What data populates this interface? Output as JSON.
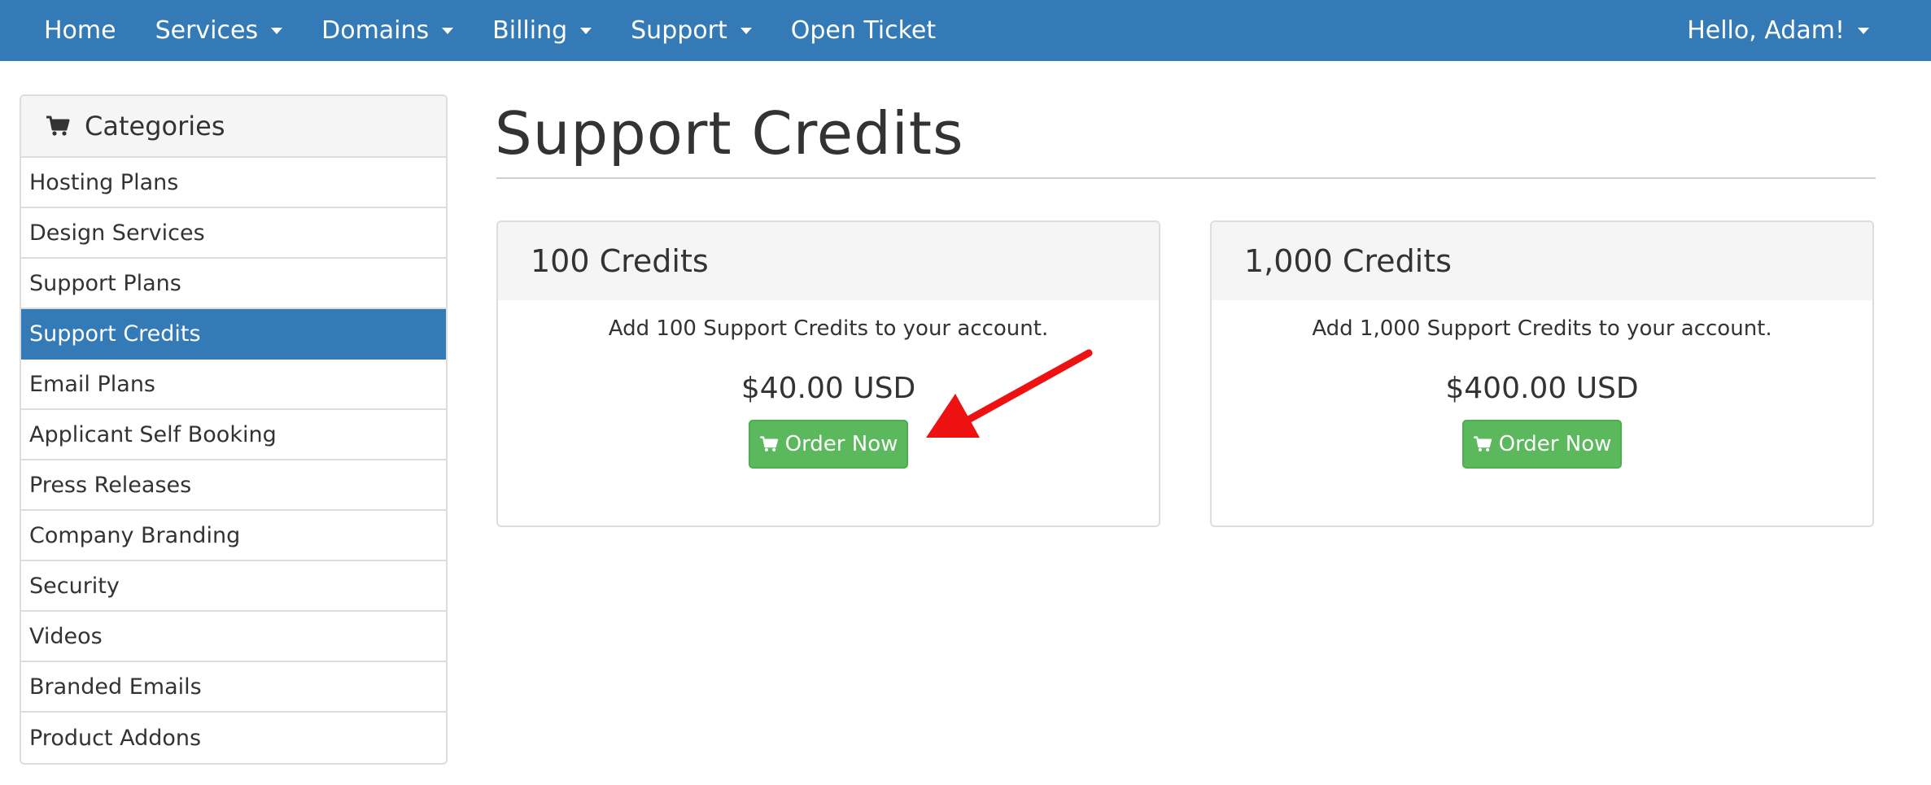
{
  "nav": {
    "items": [
      {
        "label": "Home",
        "dropdown": false
      },
      {
        "label": "Services",
        "dropdown": true
      },
      {
        "label": "Domains",
        "dropdown": true
      },
      {
        "label": "Billing",
        "dropdown": true
      },
      {
        "label": "Support",
        "dropdown": true
      },
      {
        "label": "Open Ticket",
        "dropdown": false
      }
    ],
    "user_label": "Hello, Adam!"
  },
  "sidebar": {
    "title": "Categories",
    "icon": "shopping-cart-icon",
    "items": [
      {
        "label": "Hosting Plans"
      },
      {
        "label": "Design Services"
      },
      {
        "label": "Support Plans"
      },
      {
        "label": "Support Credits",
        "active": true
      },
      {
        "label": "Email Plans"
      },
      {
        "label": "Applicant Self Booking"
      },
      {
        "label": "Press Releases"
      },
      {
        "label": "Company Branding"
      },
      {
        "label": "Security"
      },
      {
        "label": "Videos"
      },
      {
        "label": "Branded Emails"
      },
      {
        "label": "Product Addons"
      }
    ]
  },
  "main": {
    "title": "Support Credits",
    "products": [
      {
        "name": "100 Credits",
        "description": "Add 100 Support Credits to your account.",
        "price": "$40.00 USD",
        "button_label": "Order Now"
      },
      {
        "name": "1,000 Credits",
        "description": "Add 1,000 Support Credits to your account.",
        "price": "$400.00 USD",
        "button_label": "Order Now"
      }
    ]
  },
  "colors": {
    "nav_bg": "#337ab7",
    "active_item_bg": "#337ab7",
    "order_button_bg": "#5cb85c",
    "annotation_arrow": "#ee1111"
  }
}
